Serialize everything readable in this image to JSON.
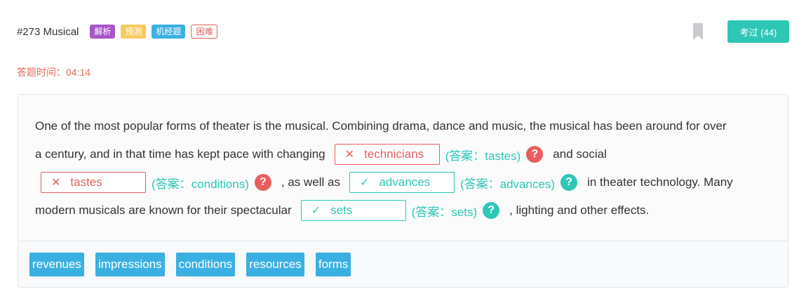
{
  "question": {
    "title": "#273 Musical",
    "tags": [
      "解析",
      "预测",
      "机经题",
      "困难"
    ]
  },
  "exam_button": "考过 (44)",
  "timer": {
    "label": "答题时间：04:14"
  },
  "passage": {
    "line1": "One of the most popular forms of theater is the musical. Combining drama, dance and music, the musical has been around for over",
    "line2_pre": "a century, and in that time has kept pace with changing",
    "line2_post": "and social",
    "line3_mid": ", as well as",
    "line3_post": "in theater technology. Many",
    "line4_pre": "modern musicals are known for their spectacular",
    "line4_post": ", lighting and other effects."
  },
  "blanks": [
    {
      "value": "technicians",
      "status": "wrong",
      "mark": "✕",
      "answer": "(答案：tastes)"
    },
    {
      "value": "tastes",
      "status": "wrong",
      "mark": "✕",
      "answer": "(答案：conditions)"
    },
    {
      "value": "advances",
      "status": "correct",
      "mark": "✓",
      "answer": "(答案：advances)"
    },
    {
      "value": "sets",
      "status": "correct",
      "mark": "✓",
      "answer": "(答案：sets)"
    }
  ],
  "help_symbol": "?",
  "options": [
    "revenues",
    "impressions",
    "conditions",
    "resources",
    "forms"
  ],
  "colors": {
    "correct": "#2ec7b6",
    "wrong": "#e95c5c",
    "option_bg": "#3ab0e2",
    "timer": "#e86a5c"
  }
}
